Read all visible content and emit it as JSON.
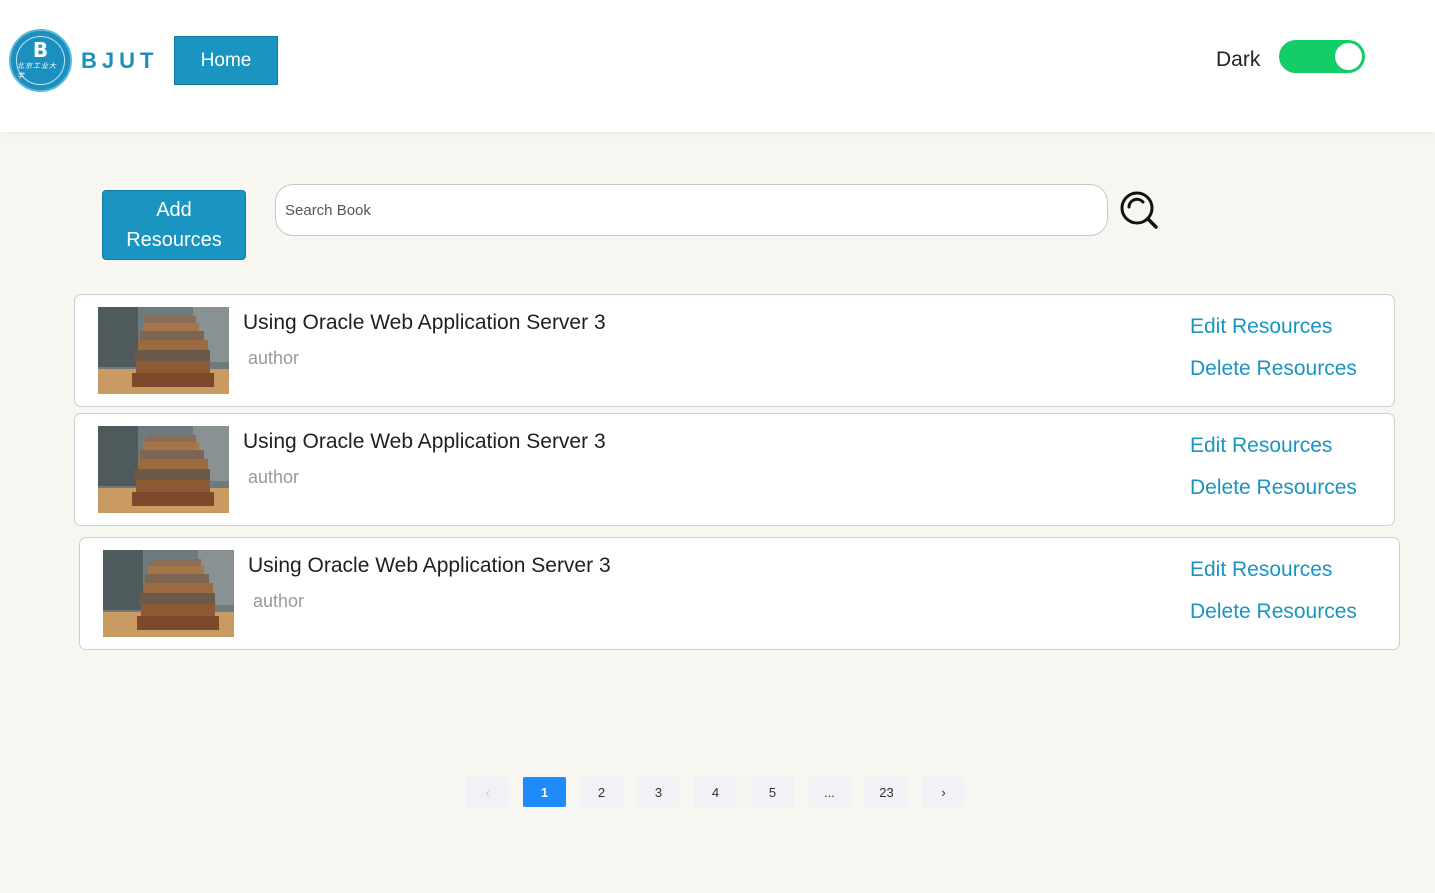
{
  "header": {
    "logo_mark": "B",
    "logo_sub": "北京工业大学",
    "brand": "BJUT",
    "home_label": "Home",
    "theme_label": "Dark",
    "theme_dark_enabled": true,
    "toggle_color": "#13ce66"
  },
  "toolbar": {
    "add_line1": "Add",
    "add_line2": "Resources",
    "search_placeholder": "Search Book",
    "search_value": ""
  },
  "resources": [
    {
      "title": "Using Oracle Web Application Server 3",
      "author": "author",
      "edit_label": "Edit Resources",
      "delete_label": "Delete Resources"
    },
    {
      "title": "Using Oracle Web Application Server 3",
      "author": "author",
      "edit_label": "Edit Resources",
      "delete_label": "Delete Resources"
    },
    {
      "title": "Using Oracle Web Application Server 3",
      "author": "author",
      "edit_label": "Edit Resources",
      "delete_label": "Delete Resources"
    }
  ],
  "pagination": {
    "prev": "‹",
    "pages": [
      "1",
      "2",
      "3",
      "4",
      "5",
      "...",
      "23"
    ],
    "next": "›",
    "current": "1"
  },
  "colors": {
    "accent": "#1a94c0",
    "page_active": "#1d8cf8",
    "background": "#f8f6f1"
  }
}
